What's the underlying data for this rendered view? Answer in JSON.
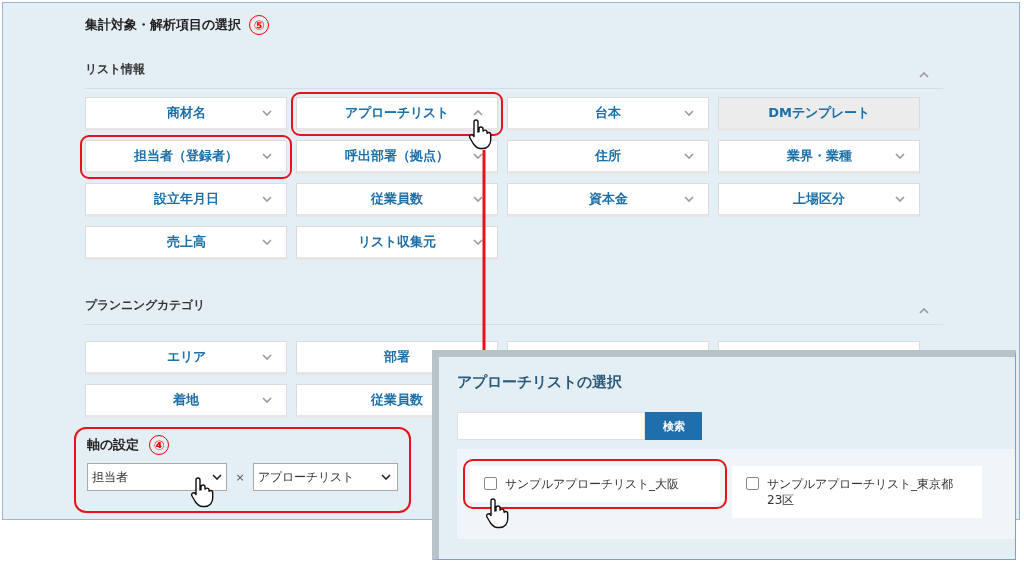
{
  "title": "集計対象・解析項目の選択",
  "title_step": "⑤",
  "sections": [
    {
      "label": "リスト情報",
      "expanded": true,
      "items": [
        {
          "kind": "dropdown",
          "label": "商材名",
          "expanded": false,
          "highlighted": false
        },
        {
          "kind": "dropdown",
          "label": "アプローチリスト",
          "expanded": true,
          "highlighted": true
        },
        {
          "kind": "dropdown",
          "label": "台本",
          "expanded": false,
          "highlighted": false
        },
        {
          "kind": "plain",
          "label": "DMテンプレート",
          "highlighted": false
        },
        {
          "kind": "dropdown",
          "label": "担当者（登録者）",
          "expanded": false,
          "highlighted": true
        },
        {
          "kind": "dropdown",
          "label": "呼出部署（拠点）",
          "expanded": false,
          "highlighted": false
        },
        {
          "kind": "dropdown",
          "label": "住所",
          "expanded": false,
          "highlighted": false
        },
        {
          "kind": "dropdown",
          "label": "業界・業種",
          "expanded": false,
          "highlighted": false
        },
        {
          "kind": "dropdown",
          "label": "設立年月日",
          "expanded": false,
          "highlighted": false
        },
        {
          "kind": "dropdown",
          "label": "従業員数",
          "expanded": false,
          "highlighted": false
        },
        {
          "kind": "dropdown",
          "label": "資本金",
          "expanded": false,
          "highlighted": false
        },
        {
          "kind": "dropdown",
          "label": "上場区分",
          "expanded": false,
          "highlighted": false
        },
        {
          "kind": "dropdown",
          "label": "売上高",
          "expanded": false,
          "highlighted": false
        },
        {
          "kind": "dropdown",
          "label": "リスト収集元",
          "expanded": false,
          "highlighted": false
        }
      ]
    },
    {
      "label": "プランニングカテゴリ",
      "expanded": true,
      "items": [
        {
          "kind": "dropdown",
          "label": "エリア",
          "expanded": false,
          "highlighted": false
        },
        {
          "kind": "partial",
          "label": "部署",
          "highlighted": false
        },
        {
          "kind": "covered"
        },
        {
          "kind": "covered"
        },
        {
          "kind": "dropdown",
          "label": "着地",
          "expanded": false,
          "highlighted": false
        },
        {
          "kind": "partial",
          "label": "従業員数",
          "highlighted": false
        }
      ]
    }
  ],
  "axis": {
    "label": "軸の設定",
    "step": "④",
    "highlighted": true,
    "x_value": "担当者",
    "separator": "×",
    "y_value": "アプローチリスト"
  },
  "dialog": {
    "title": "アプローチリストの選択",
    "search_button": "検索",
    "options": [
      {
        "label": "サンプルアプローチリスト_大阪",
        "checked": false,
        "highlighted": true
      },
      {
        "label": "サンプルアプローチリスト_東京都23区",
        "checked": false,
        "highlighted": false
      }
    ]
  }
}
